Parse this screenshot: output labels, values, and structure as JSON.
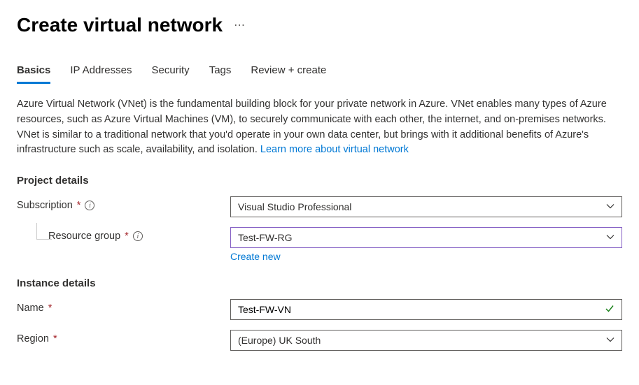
{
  "header": {
    "title": "Create virtual network",
    "ellipsis": "⋯"
  },
  "tabs": [
    {
      "label": "Basics",
      "active": true
    },
    {
      "label": "IP Addresses",
      "active": false
    },
    {
      "label": "Security",
      "active": false
    },
    {
      "label": "Tags",
      "active": false
    },
    {
      "label": "Review + create",
      "active": false
    }
  ],
  "description": {
    "text": "Azure Virtual Network (VNet) is the fundamental building block for your private network in Azure. VNet enables many types of Azure resources, such as Azure Virtual Machines (VM), to securely communicate with each other, the internet, and on-premises networks. VNet is similar to a traditional network that you'd operate in your own data center, but brings with it additional benefits of Azure's infrastructure such as scale, availability, and isolation.  ",
    "link": "Learn more about virtual network"
  },
  "sections": {
    "project": {
      "title": "Project details",
      "subscription_label": "Subscription",
      "subscription_value": "Visual Studio Professional",
      "rg_label": "Resource group",
      "rg_value": "Test-FW-RG",
      "create_new": "Create new"
    },
    "instance": {
      "title": "Instance details",
      "name_label": "Name",
      "name_value": "Test-FW-VN",
      "region_label": "Region",
      "region_value": "(Europe) UK South"
    }
  }
}
